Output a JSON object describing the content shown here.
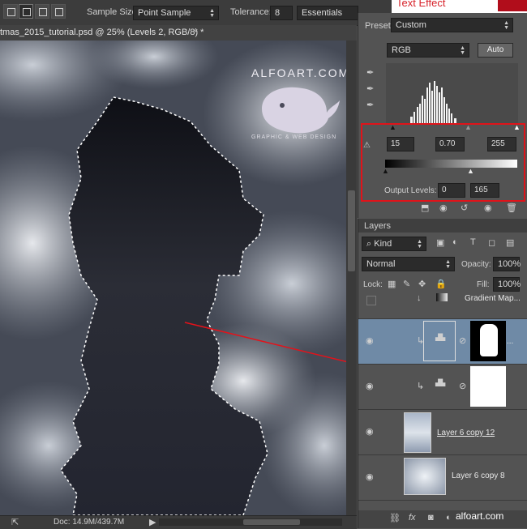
{
  "options_bar": {
    "sample_size_label": "Sample Size:",
    "sample_size_value": "Point Sample",
    "tolerance_label": "Tolerance:",
    "tolerance_value": "8",
    "workspace_value": "Essentials"
  },
  "top_right_banner": "Text Effect",
  "document_tab": {
    "title": "tmas_2015_tutorial.psd @ 25% (Levels 2, RGB/8) *",
    "close": "×"
  },
  "watermark": {
    "brand": "ALFOART.COM",
    "tagline": "GRAPHIC & WEB DESIGN"
  },
  "status_bar": {
    "doc_info": "Doc: 14.9M/439.7M"
  },
  "properties": {
    "preset_label": "Preset:",
    "preset_value": "Custom",
    "channel_value": "RGB",
    "auto_label": "Auto",
    "input_black": "15",
    "input_gamma": "0.70",
    "input_white": "255",
    "output_label": "Output Levels:",
    "output_black": "0",
    "output_white": "165",
    "colors": {
      "highlight_box": "#e0131a"
    }
  },
  "layers_panel": {
    "tab_label": "Layers",
    "filter_kind": "Kind",
    "blend_mode": "Normal",
    "opacity_label": "Opacity:",
    "opacity_value": "100%",
    "lock_label": "Lock:",
    "fill_label": "Fill:",
    "fill_value": "100%",
    "layers": [
      {
        "name": "Gradient Map..."
      },
      {
        "name": ""
      },
      {
        "name": ""
      },
      {
        "name": "Layer 6 copy 12"
      },
      {
        "name": "Layer 6 copy 8"
      }
    ]
  },
  "credit": "alfoart.com",
  "icons": [
    "eye-icon",
    "link-icon",
    "fx-icon",
    "mask-icon",
    "folder-icon",
    "trash-icon",
    "eyedropper-icon"
  ]
}
